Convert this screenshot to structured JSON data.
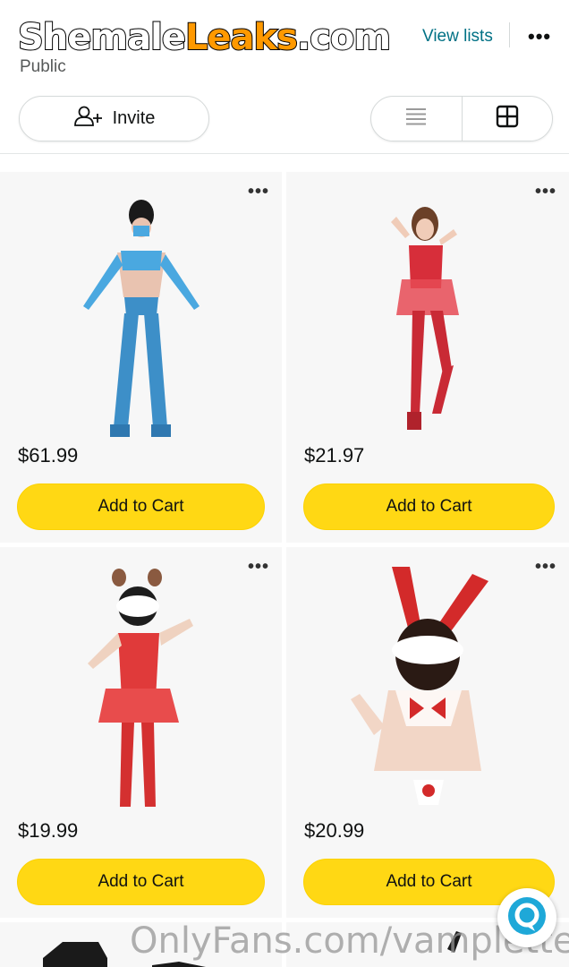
{
  "header": {
    "watermark_part_a": "Shemale",
    "watermark_part_b": "Leaks",
    "watermark_part_c": ".com",
    "visibility": "Public",
    "view_lists_label": "View lists",
    "more_label": "•••"
  },
  "actions": {
    "invite_label": "Invite",
    "invite_icon": "add-person-icon",
    "list_view_icon": "list-view-icon",
    "grid_view_icon": "grid-view-icon"
  },
  "items": [
    {
      "price": "$61.99",
      "cart_label": "Add to Cart",
      "more_label": "•••",
      "image": "blue-costume-product-image"
    },
    {
      "price": "$21.97",
      "cart_label": "Add to Cart",
      "more_label": "•••",
      "image": "red-lingerie-product-image"
    },
    {
      "price": "$19.99",
      "cart_label": "Add to Cart",
      "more_label": "•••",
      "image": "red-bunny-costume-product-image"
    },
    {
      "price": "$20.99",
      "cart_label": "Add to Cart",
      "more_label": "•••",
      "image": "bunny-ears-costume-product-image"
    }
  ],
  "footer_watermark": "OnlyFans.com/vamplette",
  "colors": {
    "cart_button": "#ffd814",
    "link": "#007185",
    "card_bg": "#f7f7f7",
    "watermark_orange": "#ff9900"
  }
}
